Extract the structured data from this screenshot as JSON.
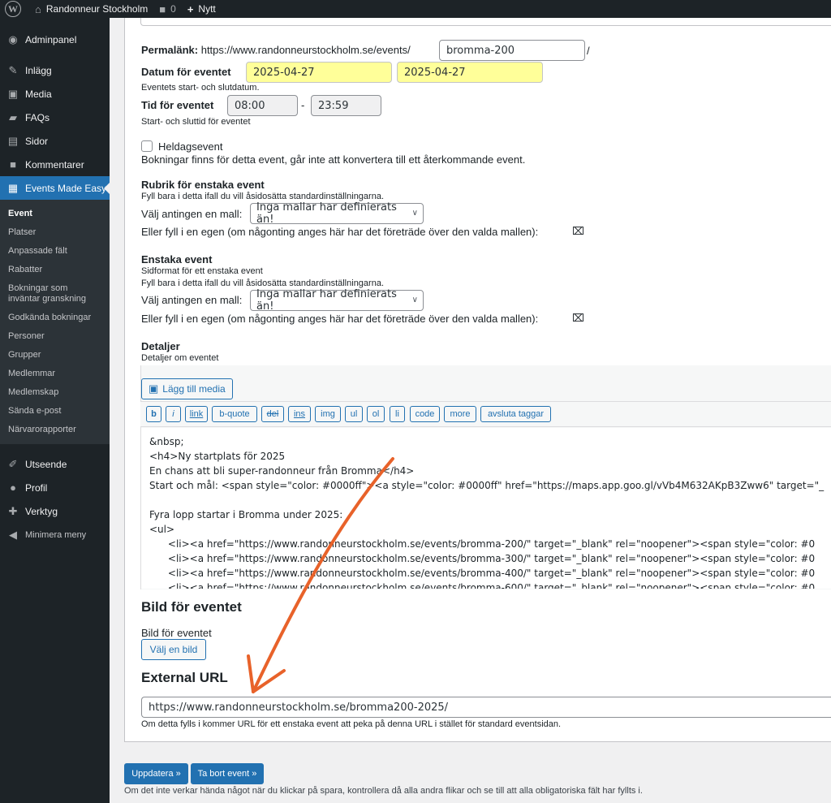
{
  "adminbar": {
    "site_name": "Randonneur Stockholm",
    "comments_count": "0",
    "new_label": "Nytt"
  },
  "sidebar": {
    "items_top": [
      {
        "label": "Adminpanel",
        "icon": "dashboard-icon"
      },
      {
        "label": "Inlägg",
        "icon": "pin-icon"
      },
      {
        "label": "Media",
        "icon": "media-icon"
      },
      {
        "label": "FAQs",
        "icon": "faq-icon"
      },
      {
        "label": "Sidor",
        "icon": "pages-icon"
      },
      {
        "label": "Kommentarer",
        "icon": "comments-icon"
      },
      {
        "label": "Events Made Easy",
        "icon": "calendar-icon"
      }
    ],
    "submenu": [
      "Event",
      "Platser",
      "Anpassade fält",
      "Rabatter",
      "Bokningar som inväntar granskning",
      "Godkända bokningar",
      "Personer",
      "Grupper",
      "Medlemmar",
      "Medlemskap",
      "Sända e-post",
      "Närvarorapporter"
    ],
    "items_bottom": [
      {
        "label": "Utseende",
        "icon": "appearance-icon"
      },
      {
        "label": "Profil",
        "icon": "user-icon"
      },
      {
        "label": "Verktyg",
        "icon": "tools-icon"
      },
      {
        "label": "Minimera meny",
        "icon": "collapse-icon"
      }
    ]
  },
  "form": {
    "permalink_label": "Permalänk:",
    "permalink_base": "https://www.randonneurstockholm.se/events/",
    "permalink_slug": "bromma-200",
    "permalink_trail": "/",
    "date_label": "Datum för eventet",
    "date_start": "2025-04-27",
    "date_end": "2025-04-27",
    "date_help": "Eventets start- och slutdatum.",
    "time_label": "Tid för eventet",
    "time_start": "08:00",
    "time_sep": "-",
    "time_end": "23:59",
    "time_help": "Start- och sluttid för eventet",
    "allday_label": "Heldagsevent",
    "allday_help": "Bokningar finns för detta event, går inte att konvertera till ett återkommande event.",
    "single_title_heading": "Rubrik för enstaka event",
    "single_title_help": "Fyll bara i detta ifall du vill åsidosätta standardinställningarna.",
    "choose_template_label": "Välj antingen en mall:",
    "template_option": "Inga mallar har definierats än!",
    "own_label": "Eller fyll i en egen (om någonting anges här har det företräde över den valda mallen):",
    "single_event_heading": "Enstaka event",
    "single_event_sub": "Sidformat för ett enstaka event",
    "single_event_help": "Fyll bara i detta ifall du vill åsidosätta standardinställningarna.",
    "details_heading": "Detaljer",
    "details_sub": "Detaljer om eventet",
    "add_media": "Lägg till media",
    "quicktags": [
      "b",
      "i",
      "link",
      "b-quote",
      "del",
      "ins",
      "img",
      "ul",
      "ol",
      "li",
      "code",
      "more",
      "avsluta taggar"
    ],
    "editor_lines": [
      "&nbsp;",
      "<h4>Ny startplats för 2025",
      "En chans att bli super-randonneur från Bromma</h4>",
      "Start och mål: <span style=\"color: #0000ff\"><a style=\"color: #0000ff\" href=\"https://maps.app.goo.gl/vVb4M632AKpB3Zww6\" target=\"_",
      "",
      "Fyra lopp startar i Bromma under 2025:",
      "<ul>",
      "\t<li><a href=\"https://www.randonneurstockholm.se/events/bromma-200/\" target=\"_blank\" rel=\"noopener\"><span style=\"color: #0",
      "\t<li><a href=\"https://www.randonneurstockholm.se/events/bromma-300/\" target=\"_blank\" rel=\"noopener\"><span style=\"color: #0",
      "\t<li><a href=\"https://www.randonneurstockholm.se/events/bromma-400/\" target=\"_blank\" rel=\"noopener\"><span style=\"color: #0",
      "\t<li><a href=\"https://www.randonneurstockholm.se/events/bromma-600/\" target=\"_blank\" rel=\"noopener\"><span style=\"color: #0"
    ],
    "image_heading": "Bild för eventet",
    "image_label": "Bild för eventet",
    "choose_image": "Välj en bild",
    "external_heading": "External URL",
    "external_value": "https://www.randonneurstockholm.se/bromma200-2025/",
    "external_help": "Om detta fylls i kommer URL för ett enstaka event att peka på denna URL i stället för standard eventsidan."
  },
  "actions": {
    "update": "Uppdatera »",
    "delete": "Ta bort event »",
    "note": "Om det inte verkar hända något när du klickar på spara, kontrollera då alla andra flikar och se till att alla obligatoriska fält har fyllts i."
  },
  "colors": {
    "accent": "#2271b1",
    "annotation_arrow": "#e8622a",
    "date_highlight": "#ffff99"
  }
}
